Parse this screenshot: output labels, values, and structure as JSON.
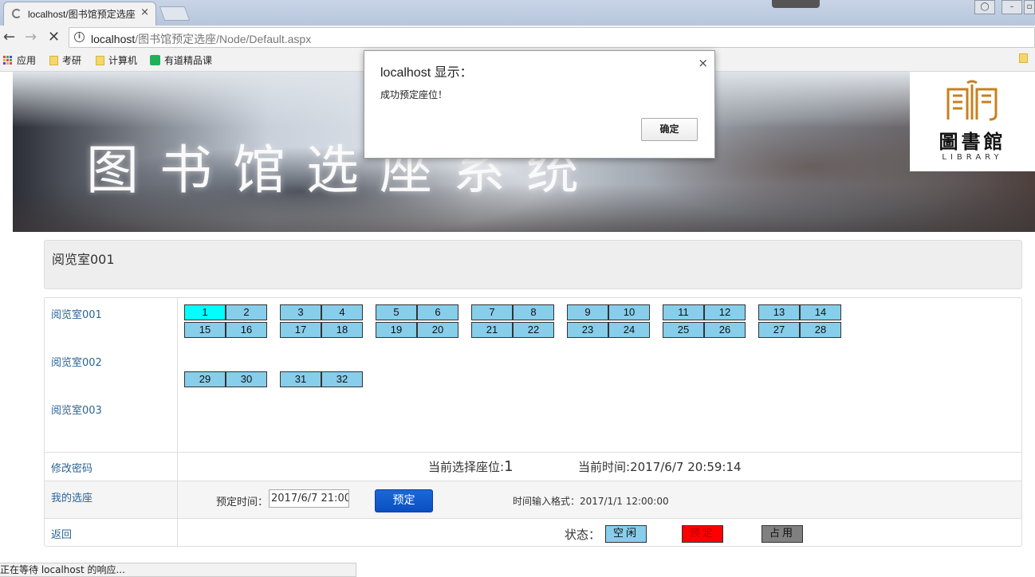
{
  "browser": {
    "tab_title": "localhost/图书馆预定选座",
    "tab_close": "×",
    "url_host": "localhost",
    "url_path": "/图书馆预定选座/Node/Default.aspx",
    "back_icon": "←",
    "forward_icon": "→",
    "stop_icon": "✕",
    "info_icon": "i",
    "bookmarks": [
      {
        "label": "应用",
        "icon": "apps-grid-icon"
      },
      {
        "label": "考研",
        "icon": "folder-icon"
      },
      {
        "label": "计算机",
        "icon": "folder-icon"
      },
      {
        "label": "有道精品课",
        "icon": "youdao-icon"
      }
    ],
    "status_text": "正在等待 localhost 的响应..."
  },
  "banner": {
    "title": "图书馆选座系统",
    "logo_cn": "圖書館",
    "logo_en": "LIBRARY"
  },
  "room_header": "阅览室001",
  "sidebar": {
    "rooms": [
      "阅览室001",
      "阅览室002",
      "阅览室003"
    ],
    "change_password": "修改密码",
    "my_booking": "我的选座",
    "back": "返回"
  },
  "seats": {
    "selected": "1",
    "row_a": [
      "1",
      "2",
      "3",
      "4",
      "5",
      "6",
      "7",
      "8",
      "9",
      "10",
      "11",
      "12",
      "13",
      "14"
    ],
    "row_b": [
      "15",
      "16",
      "17",
      "18",
      "19",
      "20",
      "21",
      "22",
      "23",
      "24",
      "25",
      "26",
      "27",
      "28"
    ],
    "row_c": [
      "29",
      "30",
      "31",
      "32"
    ]
  },
  "info": {
    "current_seat_label": "当前选择座位:",
    "current_seat_value": "1",
    "current_time_label": "当前时间:",
    "current_time_value": "2017/6/7 20:59:14"
  },
  "booking": {
    "time_label": "预定时间：",
    "time_value": "2017/6/7 21:00:",
    "button": "预定",
    "format_hint": "时间输入格式：2017/1/1 12:00:00"
  },
  "status_legend": {
    "label": "状态：",
    "items": [
      {
        "label": "空闲",
        "color": "#87ceeb",
        "text_color": "#111"
      },
      {
        "label": "预定",
        "color": "#ff0000",
        "text_color": "#b00"
      },
      {
        "label": "占用",
        "color": "#808080",
        "text_color": "#111"
      }
    ]
  },
  "dialog": {
    "title": "localhost 显示：",
    "message": "成功预定座位！",
    "ok": "确定",
    "close": "×"
  }
}
